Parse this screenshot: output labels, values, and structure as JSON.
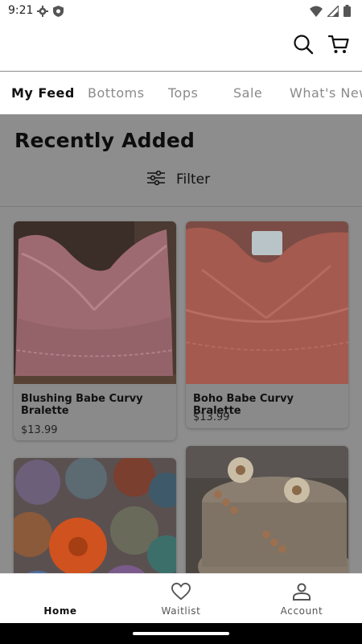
{
  "status": {
    "time": "9:21"
  },
  "tabs": [
    "My Feed",
    "Bottoms",
    "Tops",
    "Sale",
    "What's New"
  ],
  "section": {
    "title": "Recently Added",
    "filter_label": "Filter"
  },
  "products": [
    {
      "name": "Blushing Babe Curvy Bralette",
      "price": "$13.99"
    },
    {
      "name": "Boho Babe Curvy Bralette",
      "price": "$13.99"
    }
  ],
  "bottom_nav": {
    "home": "Home",
    "waitlist": "Waitlist",
    "account": "Account"
  },
  "colors": {
    "accent": "#111111",
    "overlay": "#8d8d8d",
    "bralette_pink": "#9e6a72",
    "bralette_coral": "#a55a4f"
  },
  "icons": [
    "settings-icon",
    "shield-icon",
    "wifi-icon",
    "signal-icon",
    "battery-icon",
    "search-icon",
    "cart-icon",
    "filter-icon",
    "home-icon",
    "heart-icon",
    "account-icon"
  ]
}
